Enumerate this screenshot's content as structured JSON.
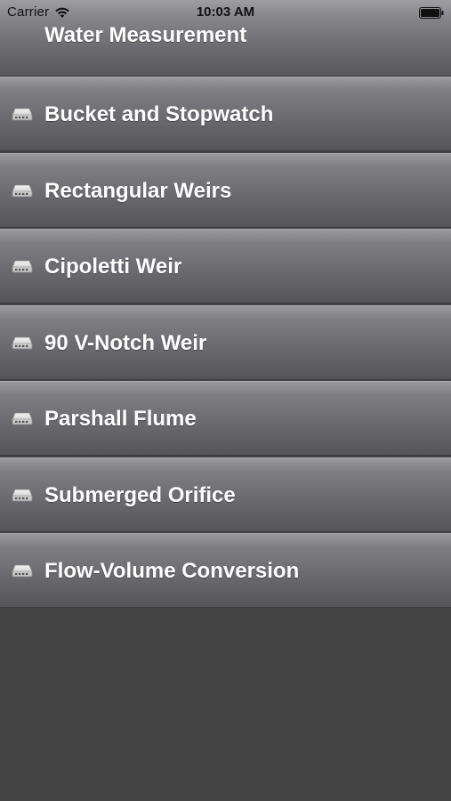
{
  "status_bar": {
    "carrier": "Carrier",
    "time": "10:03 AM",
    "wifi_icon": "wifi-icon",
    "battery_icon": "battery-icon"
  },
  "header": {
    "title": "Water Measurement"
  },
  "menu": {
    "item_icon": "disk-drive-icon",
    "items": [
      {
        "label": "Bucket and Stopwatch"
      },
      {
        "label": "Rectangular Weirs"
      },
      {
        "label": "Cipoletti Weir"
      },
      {
        "label": "90 V-Notch Weir"
      },
      {
        "label": "Parshall Flume"
      },
      {
        "label": "Submerged Orifice"
      },
      {
        "label": "Flow-Volume Conversion"
      }
    ]
  },
  "colors": {
    "background": "#444445",
    "row_gradient_top": "#9a9a9d",
    "row_gradient_bottom": "#555558",
    "text": "#ffffff"
  }
}
